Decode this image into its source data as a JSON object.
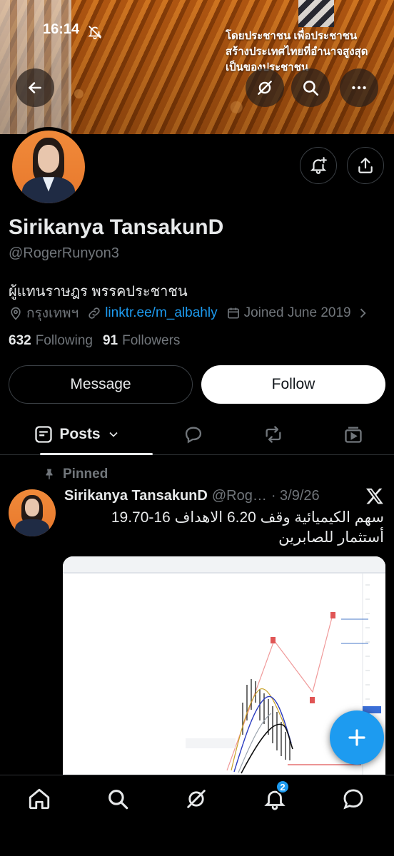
{
  "status_bar": {
    "time": "16:14"
  },
  "banner": {
    "line1": "โดยประชาชน เพื่อประชาชน",
    "line2": "สร้างประเทศไทยที่อำนาจสูงสุด",
    "line3": "เป็นของประชาชน"
  },
  "profile": {
    "name": "Sirikanya TansakunD",
    "handle": "@RogerRunyon3",
    "bio": "ผู้แทนราษฎร พรรคประชาชน",
    "location": "กรุงเทพฯ",
    "link": "linktr.ee/m_albahly",
    "joined": "Joined June 2019",
    "following_count": "632",
    "following_label": "Following",
    "followers_count": "91",
    "followers_label": "Followers"
  },
  "actions": {
    "message": "Message",
    "follow": "Follow"
  },
  "tabs": {
    "posts": "Posts"
  },
  "post": {
    "pinned_label": "Pinned",
    "author": "Sirikanya TansakunD",
    "handle": "@Rog…",
    "date": "· 3/9/26",
    "text_line1": "سهم الكيميائية وقف 6.20 الاهداف 16-19.70",
    "text_line2": "أستثمار للصابرين"
  },
  "bottom_nav": {
    "notifications_badge": "2"
  },
  "colors": {
    "accent": "#1d9bf0",
    "background": "#000000",
    "secondary_text": "#71767b"
  }
}
